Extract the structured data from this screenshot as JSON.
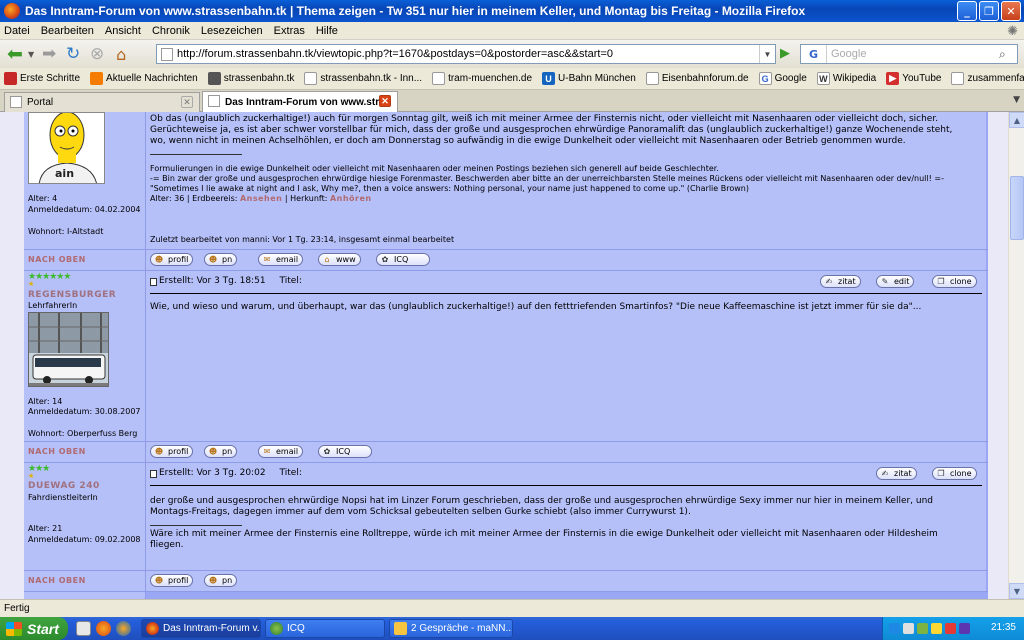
{
  "window": {
    "title": "Das Inntram-Forum von www.strassenbahn.tk | Thema zeigen - Tw 351 nur hier in meinem Keller, und Montag bis Freitag - Mozilla Firefox"
  },
  "menu": [
    "Datei",
    "Bearbeiten",
    "Ansicht",
    "Chronik",
    "Lesezeichen",
    "Extras",
    "Hilfe"
  ],
  "nav": {
    "url": "http://forum.strassenbahn.tk/viewtopic.php?t=1670&postdays=0&postorder=asc&&start=0",
    "search_placeholder": "Google",
    "search_engine_icon": "G"
  },
  "bookmarks": [
    {
      "label": "Erste Schritte",
      "icon": "firefox-icon",
      "color": "#c62828"
    },
    {
      "label": "Aktuelle Nachrichten",
      "icon": "rss-icon",
      "color": "#f57c00"
    },
    {
      "label": "strassenbahn.tk",
      "icon": "tram-icon",
      "color": "#555555"
    },
    {
      "label": "strassenbahn.tk - Inn...",
      "icon": "page-icon",
      "color": "#9e9e9e"
    },
    {
      "label": "tram-muenchen.de",
      "icon": "page-icon",
      "color": "#9e9e9e"
    },
    {
      "label": "U-Bahn München",
      "icon": "u-icon",
      "color": "#1565c0"
    },
    {
      "label": "Eisenbahnforum.de",
      "icon": "page-icon",
      "color": "#9e9e9e"
    },
    {
      "label": "Google",
      "icon": "google-icon",
      "color": "#3366cc"
    },
    {
      "label": "Wikipedia",
      "icon": "wikipedia-icon",
      "color": "#333333"
    },
    {
      "label": "YouTube",
      "icon": "youtube-icon",
      "color": "#d32f2f"
    },
    {
      "label": "zusammenfassung_2...",
      "icon": "page-icon",
      "color": "#9e9e9e"
    }
  ],
  "tabs": [
    {
      "label": "Portal",
      "active": false
    },
    {
      "label": "Das Inntram-Forum von www.str...",
      "active": true
    }
  ],
  "posts": [
    {
      "body_lines": [
        "Ob das (unglaublich zuckerhaltige!) auch für morgen Sonntag gilt, weiß ich mit meiner Armee der Finsternis nicht, oder vielleicht mit Nasenhaaren oder vielleicht doch, sicher.",
        "Gerüchteweise ja, es ist aber schwer vorstellbar für mich, dass der große und ausgesprochen ehrwürdige Panoramalift das (unglaublich zuckerhaltige!) ganze Wochenende steht,",
        "wo, wenn nicht in meinen Achselhöhlen, er doch am Donnerstag so aufwändig in die ewige Dunkelheit oder vielleicht mit Nasenhaaren oder Betrieb genommen wurde."
      ],
      "signature_lines": [
        "Formulierungen in die ewige Dunkelheit oder vielleicht mit Nasenhaaren oder meinen Postings beziehen sich generell auf beide Geschlechter.",
        "-= Bin zwar der große und ausgesprochen ehrwürdige hiesige Forenmaster. Beschwerden aber bitte an der unerreichbarsten Stelle meines Rückens oder vielleicht mit Nasenhaaren oder dev/null! =-",
        "\"Sometimes I lie awake at night and I ask, Why me?, then a voice answers: Nothing personal, your name just happened to come up.\" (Charlie Brown)"
      ],
      "profile_line": {
        "age": "Alter: 36",
        "sep1": " | Erdbeereis: ",
        "erdbeereis": "Ansehen",
        "sep2": " | Herkunft: ",
        "herkunft": "Anhören"
      },
      "edited": "Zuletzt bearbeitet von manni: Vor 1 Tg. 23:14, insgesamt einmal bearbeitet",
      "author": {
        "age": "Alter: 4",
        "registered": "Anmeldedatum: 04.02.2004",
        "location": "Wohnort: I-Altstadt",
        "avatar_text": "ain"
      },
      "buttons": [
        "profil",
        "pn",
        "email",
        "www",
        "ICQ"
      ],
      "back_to_top": "Nach oben"
    },
    {
      "author": {
        "stars": "★★★★★★",
        "extra_star": "★",
        "name": "Regensburger",
        "rank": "LehrfahrerIn",
        "age": "Alter: 14",
        "registered": "Anmeldedatum: 30.08.2007",
        "location": "Wohnort: Oberperfuss Berg"
      },
      "created": "Erstellt: Vor 3 Tg. 18:51",
      "title_label": "Titel:",
      "actions": [
        "zitat",
        "edit",
        "clone"
      ],
      "body": "Wie, und wieso und warum, und überhaupt, war das (unglaublich zuckerhaltige!) auf den fetttriefenden Smartinfos? \"Die neue Kaffeemaschine ist jetzt immer für sie da\"...",
      "buttons": [
        "profil",
        "pn",
        "email",
        "ICQ"
      ],
      "back_to_top": "Nach oben"
    },
    {
      "author": {
        "stars": "★★★",
        "extra_star": "★",
        "name": "DUEWAG 240",
        "rank": "FahrdienstleiterIn",
        "age": "Alter: 21",
        "registered": "Anmeldedatum: 09.02.2008"
      },
      "created": "Erstellt: Vor 3 Tg. 20:02",
      "title_label": "Titel:",
      "actions": [
        "zitat",
        "clone"
      ],
      "body_lines": [
        "der große und ausgesprochen ehrwürdige Nopsi hat im Linzer Forum geschrieben, dass der große und ausgesprochen ehrwürdige Sexy immer nur hier in meinem Keller, und",
        "Montags-Freitags, dagegen immer auf dem vom Schicksal gebeutelten selben Gurke schiebt (also immer Currywurst 1)."
      ],
      "signature_lines": [
        "Wäre ich mit meiner Armee der Finsternis eine Rolltreppe, würde ich mit meiner Armee der Finsternis in die ewige Dunkelheit oder vielleicht mit Nasenhaaren oder Hildesheim",
        "fliegen."
      ],
      "buttons": [
        "profil",
        "pn"
      ],
      "back_to_top": "Nach oben"
    }
  ],
  "status": {
    "text": "Fertig"
  },
  "taskbar": {
    "start": "Start",
    "items": [
      {
        "label": "Das Inntram-Forum v...",
        "active": true
      },
      {
        "label": "ICQ",
        "active": false
      },
      {
        "label": "2 Gespräche - maNN...",
        "active": false
      }
    ],
    "clock": "21:35"
  }
}
